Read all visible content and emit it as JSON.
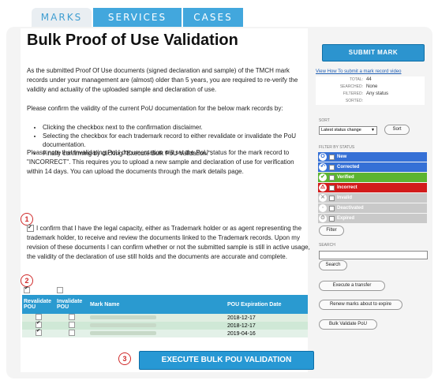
{
  "tabs": [
    "MARKS",
    "SERVICES",
    "CASES"
  ],
  "page_title": "Bulk Proof of Use Validation",
  "intro_paragraph": "As the submitted Proof Of Use documents (signed declaration and sample) of the TMCH mark records under your management are (almost) older than 5 years, you are required to re-verify the validity and actuality of the uploaded sample and declaration of use.",
  "confirm_paragraph": "Please confirm the validity of the current PoU documentation for the below mark records by:",
  "steps": [
    "Clicking the checkbox next to the confirmation disclaimer.",
    "Selecting the checkbox for each trademark record to either revalidate or invalidate the PoU documentation.",
    "Finally confirming by clicking \"Execute Bulk PoU Validation.\"."
  ],
  "warning_paragraph": "Please note that invalidating PoU documentation will set the PoU status for the mark record to \"INCORRECT\". This requires you to upload a new sample and declaration of use for verification within 14 days. You can upload the documents through the mark details page.",
  "disclaimer": "I confirm that I have the legal capacity, either as Trademark holder or as agent representing the trademark holder, to receive and review the documents linked to the Trademark records. Upon my revision of these documents I can confirm whether or not the submitted sample is still in active usage, the validity of the declaration of use still holds and the documents are accurate and complete.",
  "annotations": [
    "1",
    "2",
    "3"
  ],
  "table": {
    "headers": [
      "Revalidate POU",
      "Invalidate POU",
      "Mark Name",
      "POU Expiration Date"
    ],
    "rows": [
      {
        "revalidate": false,
        "invalidate": false,
        "date": "2018-12-17"
      },
      {
        "revalidate": true,
        "invalidate": false,
        "date": "2018-12-17"
      },
      {
        "revalidate": true,
        "invalidate": false,
        "date": "2019-04-16"
      }
    ]
  },
  "execute_button": "EXECUTE BULK POU VALIDATION",
  "sidebar": {
    "submit_button": "SUBMIT MARK",
    "video_link": "View How To submit a mark record video",
    "stats": [
      {
        "k": "TOTAL:",
        "v": "44"
      },
      {
        "k": "SEARCHED:",
        "v": "None"
      },
      {
        "k": "FILTERED:",
        "v": "Any status"
      },
      {
        "k": "SORTED:",
        "v": ""
      }
    ],
    "sort_label": "SORT",
    "sort_value": "Latest status change",
    "sort_button": "Sort",
    "filter_label": "FILTER BY STATUS",
    "statuses": [
      {
        "label": "New",
        "color": "#3570d6",
        "icon": "O"
      },
      {
        "label": "Corrected",
        "color": "#3570d6",
        "icon": "↶"
      },
      {
        "label": "Verified",
        "color": "#5cb431",
        "icon": "✔"
      },
      {
        "label": "Incorrect",
        "color": "#d21b1b",
        "icon": "⚠"
      },
      {
        "label": "Invalid",
        "color": "#c9c9c9",
        "icon": "✕"
      },
      {
        "label": "Deactivated",
        "color": "#c9c9c9",
        "icon": "◦"
      },
      {
        "label": "Expired",
        "color": "#c9c9c9",
        "icon": "⏱"
      }
    ],
    "filter_button": "Filter",
    "search_label": "SEARCH",
    "search_button": "Search",
    "actions": [
      "Execute a transfer",
      "Renew marks about to expire",
      "Bulk Validate PoU"
    ]
  }
}
